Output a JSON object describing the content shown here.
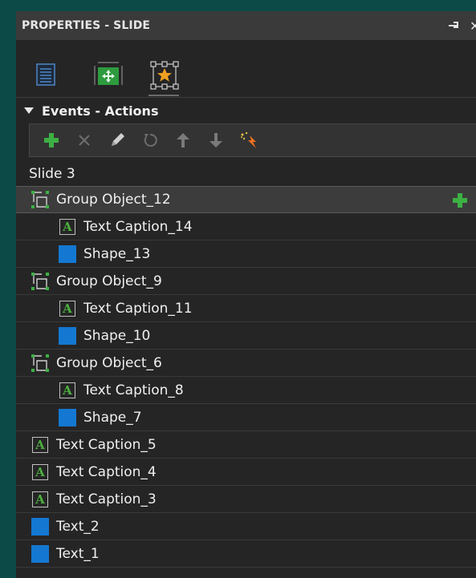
{
  "panel": {
    "title": "PROPERTIES - SLIDE"
  },
  "tabs": [
    {
      "icon": "list-properties-icon",
      "active": false
    },
    {
      "icon": "slide-options-icon",
      "active": false
    },
    {
      "icon": "actions-star-icon",
      "active": true
    }
  ],
  "section": {
    "title": "Events - Actions",
    "expanded": true
  },
  "toolbar": {
    "buttons": [
      {
        "icon": "add-icon",
        "enabled": true
      },
      {
        "icon": "delete-icon",
        "enabled": false
      },
      {
        "icon": "edit-icon",
        "enabled": true
      },
      {
        "icon": "reset-icon",
        "enabled": false
      },
      {
        "icon": "move-up-icon",
        "enabled": false
      },
      {
        "icon": "move-down-icon",
        "enabled": false
      },
      {
        "icon": "effects-icon",
        "enabled": true
      }
    ]
  },
  "tree": {
    "root": "Slide 3",
    "items": [
      {
        "label": "Group Object_12",
        "type": "group",
        "level": 1,
        "selected": true
      },
      {
        "label": "Text Caption_14",
        "type": "caption",
        "level": 2
      },
      {
        "label": "Shape_13",
        "type": "shape",
        "level": 2
      },
      {
        "label": "Group Object_9",
        "type": "group",
        "level": 1
      },
      {
        "label": "Text Caption_11",
        "type": "caption",
        "level": 2
      },
      {
        "label": "Shape_10",
        "type": "shape",
        "level": 2
      },
      {
        "label": "Group Object_6",
        "type": "group",
        "level": 1
      },
      {
        "label": "Text Caption_8",
        "type": "caption",
        "level": 2
      },
      {
        "label": "Shape_7",
        "type": "shape",
        "level": 2
      },
      {
        "label": "Text Caption_5",
        "type": "caption",
        "level": 1
      },
      {
        "label": "Text Caption_4",
        "type": "caption",
        "level": 1
      },
      {
        "label": "Text Caption_3",
        "type": "caption",
        "level": 1
      },
      {
        "label": "Text_2",
        "type": "shape",
        "level": 1
      },
      {
        "label": "Text_1",
        "type": "shape",
        "level": 1
      }
    ]
  },
  "colors": {
    "accent_green": "#3cb043",
    "shape_blue": "#1478d2"
  }
}
